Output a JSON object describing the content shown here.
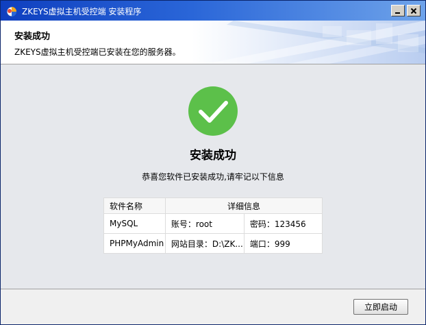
{
  "window": {
    "title": "ZKEYS虚拟主机受控端 安装程序",
    "minimize_icon": "minimize-icon",
    "close_icon": "close-icon",
    "app_icon": "installer-app-icon"
  },
  "header": {
    "title": "安装成功",
    "description": "ZKEYS虚拟主机受控端已安装在您的服务器。"
  },
  "main": {
    "status_icon": "success-check-icon",
    "success_color": "#5cc04a",
    "title": "安装成功",
    "description": "恭喜您软件已安装成功,请牢记以下信息",
    "table": {
      "headers": [
        "软件名称",
        "详细信息"
      ],
      "rows": [
        {
          "name": "MySQL",
          "detail1": "账号：root",
          "detail2": "密码：123456"
        },
        {
          "name": "PHPMyAdmin",
          "detail1": "网站目录：D:\\ZK...",
          "detail2": "端口：999"
        }
      ]
    }
  },
  "footer": {
    "start_button": "立即启动"
  }
}
